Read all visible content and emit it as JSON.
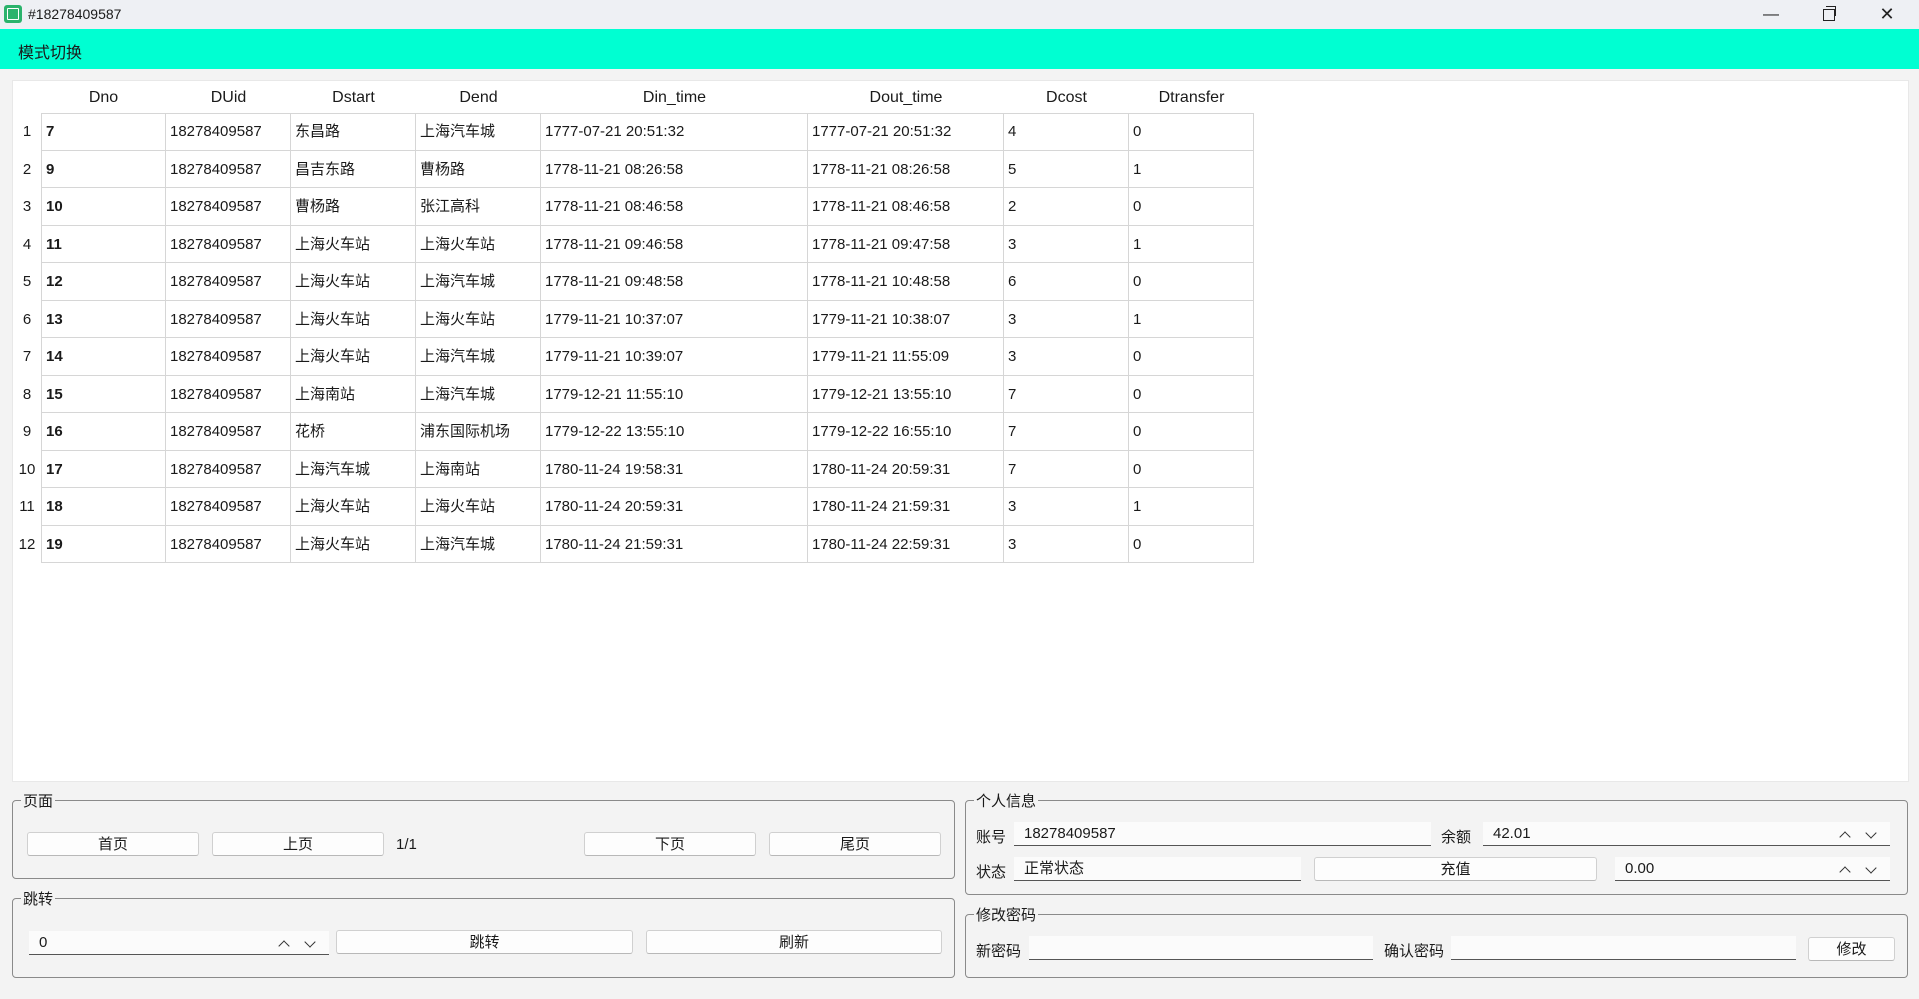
{
  "window": {
    "title": "#18278409587"
  },
  "menu": {
    "mode_switch": "模式切换"
  },
  "table": {
    "headers": [
      "Dno",
      "DUid",
      "Dstart",
      "Dend",
      "Din_time",
      "Dout_time",
      "Dcost",
      "Dtransfer"
    ],
    "rows": [
      {
        "n": "1",
        "c": [
          "7",
          "18278409587",
          "东昌路",
          "上海汽车城",
          "1777-07-21 20:51:32",
          "1777-07-21 20:51:32",
          "4",
          "0"
        ]
      },
      {
        "n": "2",
        "c": [
          "9",
          "18278409587",
          "昌吉东路",
          "曹杨路",
          "1778-11-21 08:26:58",
          "1778-11-21 08:26:58",
          "5",
          "1"
        ]
      },
      {
        "n": "3",
        "c": [
          "10",
          "18278409587",
          "曹杨路",
          "张江高科",
          "1778-11-21 08:46:58",
          "1778-11-21 08:46:58",
          "2",
          "0"
        ]
      },
      {
        "n": "4",
        "c": [
          "11",
          "18278409587",
          "上海火车站",
          "上海火车站",
          "1778-11-21 09:46:58",
          "1778-11-21 09:47:58",
          "3",
          "1"
        ]
      },
      {
        "n": "5",
        "c": [
          "12",
          "18278409587",
          "上海火车站",
          "上海汽车城",
          "1778-11-21 09:48:58",
          "1778-11-21 10:48:58",
          "6",
          "0"
        ]
      },
      {
        "n": "6",
        "c": [
          "13",
          "18278409587",
          "上海火车站",
          "上海火车站",
          "1779-11-21 10:37:07",
          "1779-11-21 10:38:07",
          "3",
          "1"
        ]
      },
      {
        "n": "7",
        "c": [
          "14",
          "18278409587",
          "上海火车站",
          "上海汽车城",
          "1779-11-21 10:39:07",
          "1779-11-21 11:55:09",
          "3",
          "0"
        ]
      },
      {
        "n": "8",
        "c": [
          "15",
          "18278409587",
          "上海南站",
          "上海汽车城",
          "1779-12-21 11:55:10",
          "1779-12-21 13:55:10",
          "7",
          "0"
        ]
      },
      {
        "n": "9",
        "c": [
          "16",
          "18278409587",
          "花桥",
          "浦东国际机场",
          "1779-12-22 13:55:10",
          "1779-12-22 16:55:10",
          "7",
          "0"
        ]
      },
      {
        "n": "10",
        "c": [
          "17",
          "18278409587",
          "上海汽车城",
          "上海南站",
          "1780-11-24 19:58:31",
          "1780-11-24 20:59:31",
          "7",
          "0"
        ]
      },
      {
        "n": "11",
        "c": [
          "18",
          "18278409587",
          "上海火车站",
          "上海火车站",
          "1780-11-24 20:59:31",
          "1780-11-24 21:59:31",
          "3",
          "1"
        ]
      },
      {
        "n": "12",
        "c": [
          "19",
          "18278409587",
          "上海火车站",
          "上海汽车城",
          "1780-11-24 21:59:31",
          "1780-11-24 22:59:31",
          "3",
          "0"
        ]
      }
    ]
  },
  "paging": {
    "title": "页面",
    "first": "首页",
    "prev": "上页",
    "indicator": "1/1",
    "next": "下页",
    "last": "尾页"
  },
  "jump": {
    "title": "跳转",
    "value": "0",
    "jump_button": "跳转",
    "refresh_button": "刷新"
  },
  "profile": {
    "title": "个人信息",
    "account_label": "账号",
    "account_value": "18278409587",
    "balance_label": "余额",
    "balance_value": "42.01",
    "status_label": "状态",
    "status_value": "正常状态",
    "recharge_button": "充值",
    "recharge_amount": "0.00"
  },
  "password": {
    "title": "修改密码",
    "new_label": "新密码",
    "confirm_label": "确认密码",
    "submit": "修改"
  },
  "colors": {
    "menubar": "#00ffd2",
    "titlebar": "#eef0f4",
    "background": "#f3f3f3"
  }
}
